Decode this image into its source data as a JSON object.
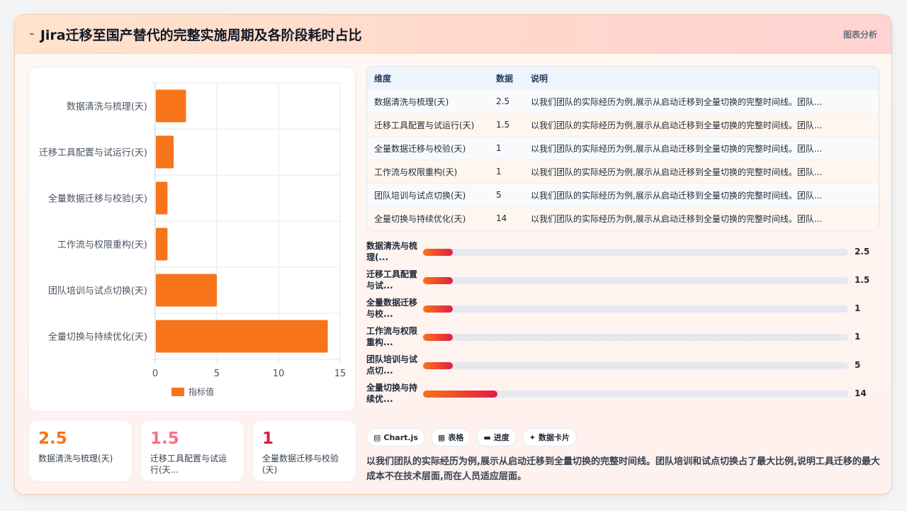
{
  "header": {
    "title": "Jira迁移至国产替代的完整实施周期及各阶段耗时占比",
    "icon": "chart-icon",
    "right_label": "图表分析"
  },
  "chart_data": {
    "type": "bar",
    "orientation": "horizontal",
    "categories": [
      "数据清洗与梳理(天)",
      "迁移工具配置与试运行(天)",
      "全量数据迁移与校验(天)",
      "工作流与权限重构(天)",
      "团队培训与试点切换(天)",
      "全量切换与持续优化(天)"
    ],
    "series": [
      {
        "name": "指标值",
        "values": [
          2.5,
          1.5,
          1,
          1,
          5,
          14
        ]
      }
    ],
    "xlim": [
      0,
      15
    ],
    "xticks": [
      0,
      5,
      10,
      15
    ],
    "grid": true,
    "legend": "bottom",
    "bar_color": "#f7741a"
  },
  "kpis": [
    {
      "value": "2.5",
      "label": "数据清洗与梳理(天)",
      "color": "#f97316"
    },
    {
      "value": "1.5",
      "label": "迁移工具配置与试运行(天...",
      "color": "#f87185"
    },
    {
      "value": "1",
      "label": "全量数据迁移与校验(天)",
      "color": "#e11d48"
    }
  ],
  "table": {
    "headers": [
      "维度",
      "数据",
      "说明"
    ],
    "rows": [
      [
        "数据清洗与梳理(天)",
        "2.5",
        "以我们团队的实际经历为例,展示从启动迁移到全量切换的完整时间线。团队..."
      ],
      [
        "迁移工具配置与试运行(天)",
        "1.5",
        "以我们团队的实际经历为例,展示从启动迁移到全量切换的完整时间线。团队..."
      ],
      [
        "全量数据迁移与校验(天)",
        "1",
        "以我们团队的实际经历为例,展示从启动迁移到全量切换的完整时间线。团队..."
      ],
      [
        "工作流与权限重构(天)",
        "1",
        "以我们团队的实际经历为例,展示从启动迁移到全量切换的完整时间线。团队..."
      ],
      [
        "团队培训与试点切换(天)",
        "5",
        "以我们团队的实际经历为例,展示从启动迁移到全量切换的完整时间线。团队..."
      ],
      [
        "全量切换与持续优化(天)",
        "14",
        "以我们团队的实际经历为例,展示从启动迁移到全量切换的完整时间线。团队..."
      ]
    ]
  },
  "progress": {
    "max": 80,
    "items": [
      {
        "label": "数据清洗与梳理(...",
        "value": 2.5,
        "display": "2.5"
      },
      {
        "label": "迁移工具配置与试...",
        "value": 1.5,
        "display": "1.5"
      },
      {
        "label": "全量数据迁移与校...",
        "value": 1,
        "display": "1"
      },
      {
        "label": "工作流与权限重构...",
        "value": 1,
        "display": "1"
      },
      {
        "label": "团队培训与试点切...",
        "value": 5,
        "display": "5"
      },
      {
        "label": "全量切换与持续优...",
        "value": 14,
        "display": "14"
      }
    ]
  },
  "chips": [
    {
      "icon": "▤",
      "label": "Chart.js"
    },
    {
      "icon": "▦",
      "label": "表格"
    },
    {
      "icon": "▬",
      "label": "进度"
    },
    {
      "icon": "✦",
      "label": "数据卡片"
    }
  ],
  "description": "以我们团队的实际经历为例,展示从启动迁移到全量切换的完整时间线。团队培训和试点切换占了最大比例,说明工具迁移的最大成本不在技术层面,而在人员适应层面。"
}
